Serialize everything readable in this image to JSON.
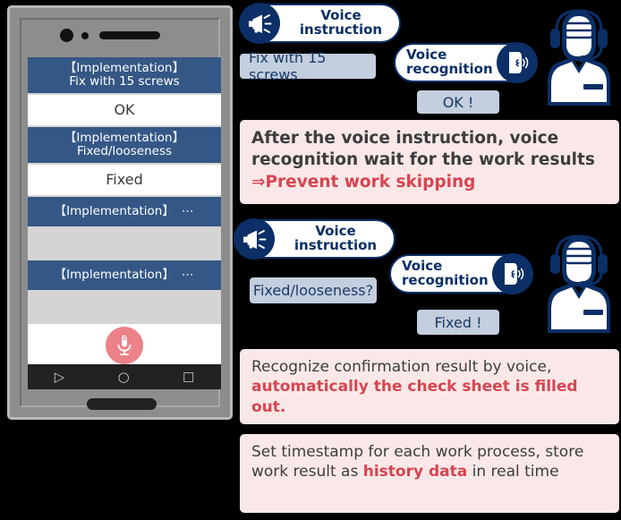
{
  "phone": {
    "device_name": "smartphone-mockup",
    "screen_rows": [
      {
        "type": "header",
        "lines": [
          "【Implementation】",
          "Fix with 15 screws"
        ]
      },
      {
        "type": "answer",
        "text": "OK"
      },
      {
        "type": "header",
        "lines": [
          "【Implementation】",
          "Fixed/looseness"
        ]
      },
      {
        "type": "answer",
        "text": "Fixed"
      },
      {
        "type": "header_short",
        "text": "【Implementation】",
        "suffix": "⋯"
      },
      {
        "type": "blank",
        "text": ""
      },
      {
        "type": "header_short",
        "text": "【Implementation】",
        "suffix": "⋯"
      },
      {
        "type": "blank",
        "text": ""
      }
    ],
    "mic_button_label": "microphone",
    "navbar": {
      "back": "▷",
      "home": "○",
      "recents": "□"
    },
    "colors": {
      "header_row": "#355785",
      "answer_row": "#ffffff",
      "blank_row": "#d4d4d4",
      "mic_button": "#ec8188",
      "navbar": "#222222",
      "body": "#8d8d8d"
    }
  },
  "flow_top": {
    "instruction_badge": {
      "label": "Voice\ninstruction",
      "icon": "megaphone-icon"
    },
    "recognition_badge": {
      "label": "Voice\nrecognition",
      "icon": "speaking-face-icon"
    },
    "instruction_speech": "Fix with 15 screws",
    "response_speech": "OK !",
    "person_icon": "headset-worker-icon"
  },
  "flow_bottom": {
    "instruction_badge": {
      "label": "Voice\ninstruction",
      "icon": "megaphone-icon"
    },
    "recognition_badge": {
      "label": "Voice\nrecognition",
      "icon": "speaking-face-icon"
    },
    "instruction_speech": "Fixed/looseness?",
    "response_speech": "Fixed !",
    "person_icon": "headset-worker-icon"
  },
  "notes": {
    "main": {
      "plain_1": "After the voice instruction, voice recognition wait for the work results ",
      "accent_1": "⇒Prevent work skipping"
    },
    "check_sheet": {
      "plain_1": "Recognize confirmation result by voice, ",
      "accent_1": "automatically the check sheet is filled out."
    },
    "history": {
      "plain_1": "Set timestamp for each work process, store work result as ",
      "accent_1": "history data",
      "plain_2": " in real time"
    }
  },
  "colors": {
    "brand_navy": "#0b2f66",
    "speech_bg": "#c3cede",
    "note_bg": "#fae8e8",
    "accent_red": "#d64550",
    "row_navy": "#355785"
  }
}
